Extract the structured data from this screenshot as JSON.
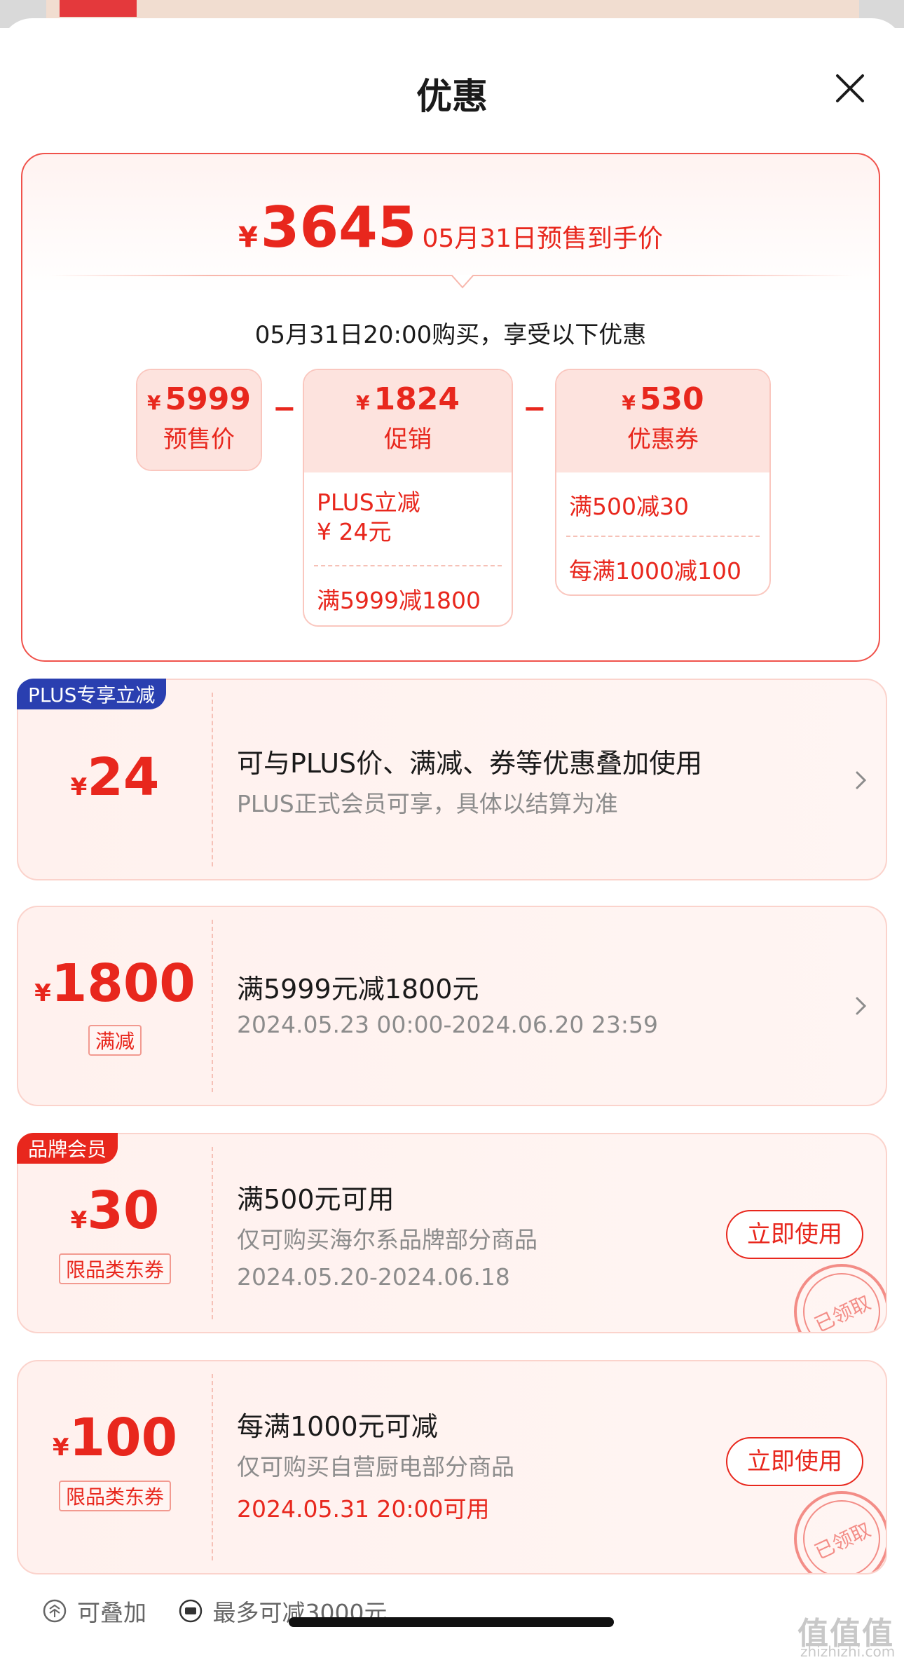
{
  "sheet": {
    "title": "优惠"
  },
  "summary": {
    "currency": "¥",
    "final_price": "3645",
    "final_caption": "05月31日预售到手价",
    "buy_note": "05月31日20:00购买，享受以下优惠",
    "breakdown": [
      {
        "amount": "5999",
        "label": "预售价",
        "rows": []
      },
      {
        "amount": "1824",
        "label": "促销",
        "rows": [
          "PLUS立减\n¥ 24元",
          "满5999减1800"
        ]
      },
      {
        "amount": "530",
        "label": "优惠券",
        "rows": [
          "满500减30",
          "每满1000减100"
        ]
      }
    ],
    "operator": "−"
  },
  "coupons": [
    {
      "badge": "PLUS专享立减",
      "badge_color": "#2a3fb0",
      "currency": "¥",
      "amount": "24",
      "chip": "",
      "title": "可与PLUS价、满减、券等优惠叠加使用",
      "line2": "PLUS正式会员可享，具体以结算为准",
      "line3": "",
      "action": ""
    },
    {
      "badge": "",
      "currency": "¥",
      "amount": "1800",
      "chip": "满减",
      "title": "满5999元减1800元",
      "line2": "2024.05.23 00:00-2024.06.20 23:59",
      "line3": "",
      "action": ""
    },
    {
      "badge": "品牌会员",
      "badge_color": "#e8271d",
      "currency": "¥",
      "amount": "30",
      "chip": "限品类东券",
      "title": "满500元可用",
      "line2": "仅可购买海尔系品牌部分商品",
      "line3": "2024.05.20-2024.06.18",
      "line3_color": "#8c8c8c",
      "action": "立即使用",
      "stamp": "已领取"
    },
    {
      "badge": "",
      "currency": "¥",
      "amount": "100",
      "chip": "限品类东券",
      "title": "每满1000元可减",
      "line2": "仅可购买自营厨电部分商品",
      "line3": "2024.05.31 20:00可用",
      "line3_color": "#e8271d",
      "action": "立即使用",
      "stamp": "已领取"
    }
  ],
  "footer": {
    "stackable": "可叠加",
    "max_off": "最多可减3000元"
  },
  "watermark": {
    "logo": "值值值",
    "site": "zhizhizhi.com"
  },
  "colors": {
    "accent": "#e8271d",
    "plus_badge": "#2a3fb0"
  }
}
